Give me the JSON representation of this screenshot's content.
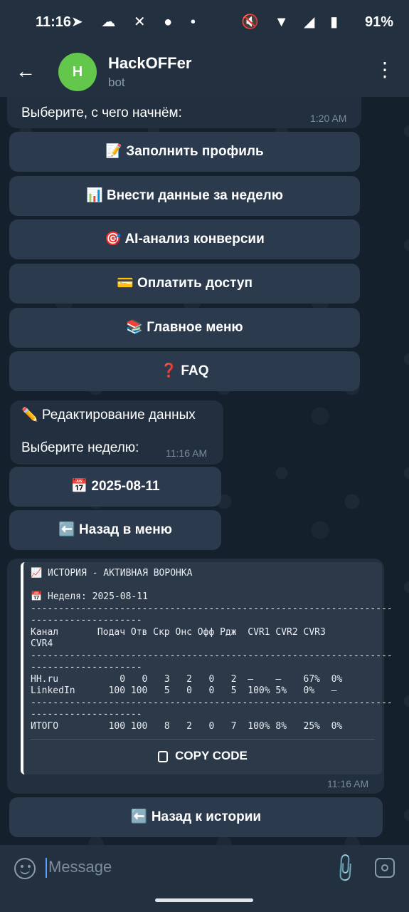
{
  "status": {
    "time": "11:16",
    "battery": "91%"
  },
  "header": {
    "back_icon": "arrow-left-icon",
    "avatar_letter": "H",
    "title": "HackOFFer",
    "subtitle": "bot"
  },
  "messages": {
    "first": {
      "text": "Выберите, с чего начнём:",
      "time": "1:20 AM"
    },
    "buttons1": [
      "📝 Заполнить профиль",
      "📊 Внести данные за неделю",
      "🎯 AI-анализ конверсии",
      "💳 Оплатить доступ",
      "📚 Главное меню",
      "❓ FAQ"
    ],
    "second": {
      "title": "✏️ Редактирование данных",
      "text": "Выберите неделю:",
      "time": "11:16 AM"
    },
    "buttons2": [
      "📅 2025-08-11",
      "⬅️ Назад в меню"
    ],
    "code": {
      "text": "📈 ИСТОРИЯ - АКТИВНАЯ ВОРОНКА\n\n📅 Неделя: 2025-08-11\n-----------------------------------------------------------------\n--------------------\nКанал       Подач Отв Скр Онс Офф Рдж  CVR1 CVR2 CVR3\nCVR4\n-----------------------------------------------------------------\n--------------------\nHH.ru           0   0   3   2   0   2  —    —    67%  0%\nLinkedIn      100 100   5   0   0   5  100% 5%   0%   —\n-----------------------------------------------------------------\n--------------------\nИТОГО         100 100   8   2   0   7  100% 8%   25%  0%",
      "copy_label": "COPY CODE",
      "time": "11:16 AM"
    },
    "buttons3": [
      "⬅️ Назад к истории"
    ]
  },
  "input": {
    "placeholder": "Message"
  }
}
